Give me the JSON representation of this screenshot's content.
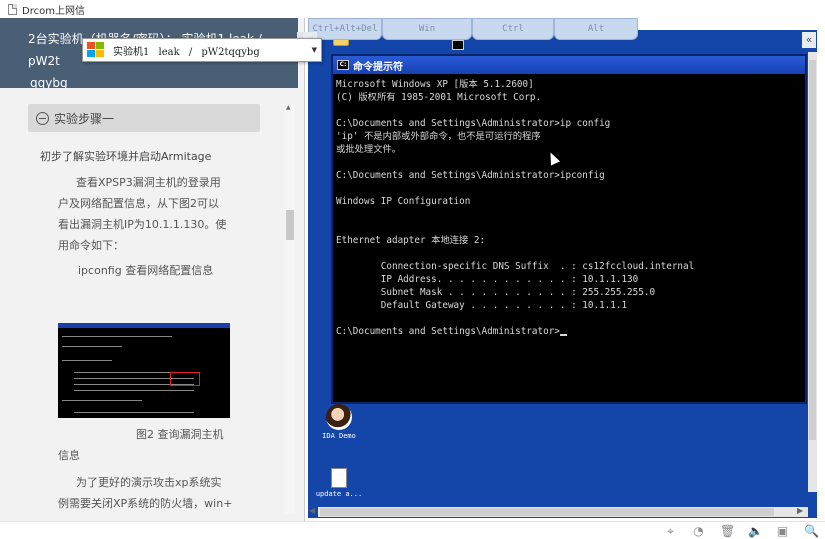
{
  "window": {
    "title": "Drcom上网信"
  },
  "left_panel": {
    "header_line1": "2台实验机（机器名/密码）： 实验机1   leak / pW2t",
    "header_line2": "qqybg",
    "collapse_icon": "«",
    "dropdown": {
      "selected": "实验机1   leak / pW2tqqybg",
      "arrow": "▼"
    },
    "step_title": "实验步骤一",
    "section_title": "初步了解实验环境并启动Armitage",
    "para1": [
      "查看XPSP3漏洞主机的登录用",
      "户及网络配置信息，从下图2可以",
      "看出漏洞主机IP为10.1.1.130。使",
      "用命令如下："
    ],
    "command_label": "ipconfig 查看网络配置信息",
    "figure_caption_1": "图2 查询漏洞主机",
    "figure_caption_2": "信息",
    "para2": [
      "为了更好的演示攻击xp系统实",
      "例需要关闭XP系统的防火墙，win+"
    ]
  },
  "remote": {
    "keys": [
      "Ctrl+Alt+Del",
      "Win",
      "Ctrl",
      "Alt"
    ],
    "collapse_icon": "«",
    "cmd": {
      "title": "命令提示符",
      "lines": [
        "Microsoft Windows XP [版本 5.1.2600]",
        "(C) 版权所有 1985-2001 Microsoft Corp.",
        "",
        "C:\\Documents and Settings\\Administrator>ip config",
        "'ip' 不是内部或外部命令，也不是可运行的程序",
        "或批处理文件。",
        "",
        "C:\\Documents and Settings\\Administrator>ipconfig",
        "",
        "Windows IP Configuration",
        "",
        "",
        "Ethernet adapter 本地连接 2:",
        "",
        "        Connection-specific DNS Suffix  . : cs12fccloud.internal",
        "        IP Address. . . . . . . . . . . . : 10.1.1.130",
        "        Subnet Mask . . . . . . . . . . . : 255.255.255.0",
        "        Default Gateway . . . . . . . . . : 10.1.1.1",
        "",
        "C:\\Documents and Settings\\Administrator>"
      ]
    },
    "desktop_icons": [
      {
        "label": "IDA Demo",
        "icon": "ida-icon"
      },
      {
        "label": "update a...",
        "icon": "file-icon"
      }
    ]
  },
  "toolbar": {
    "icons": [
      "pin-icon",
      "screenshot-icon",
      "trash-icon",
      "volume-icon",
      "window-icon",
      "search-icon"
    ],
    "glyphs": [
      "⌖",
      "◔",
      "🗑",
      "🔈",
      "▣",
      "🔍"
    ]
  }
}
